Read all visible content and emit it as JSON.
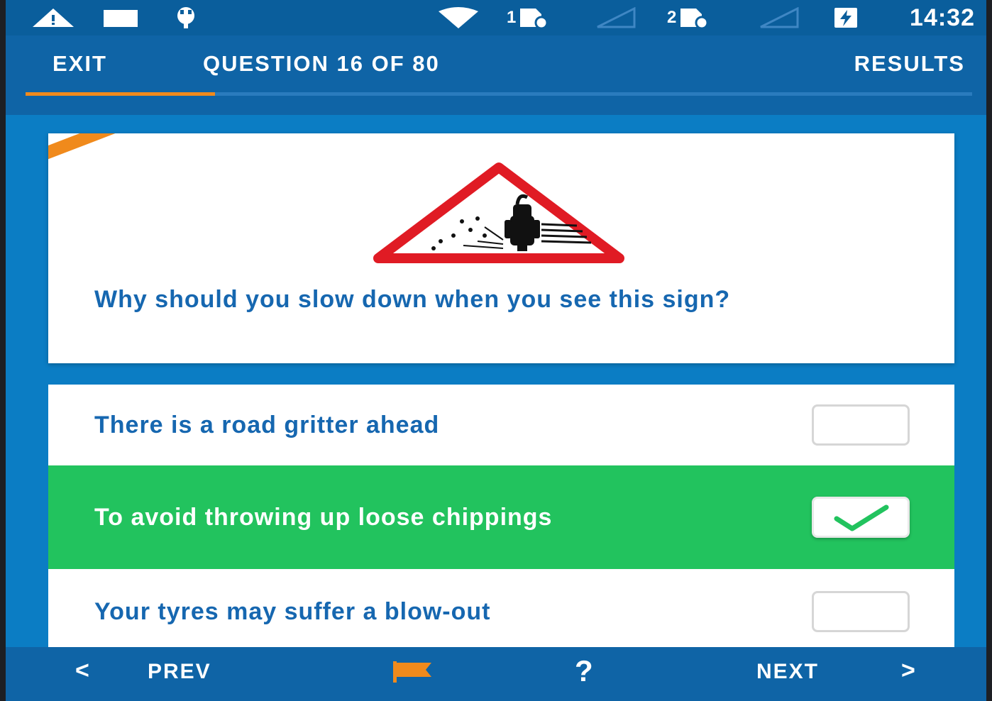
{
  "status_bar": {
    "time": "14:32",
    "sim1": "1",
    "sim2": "2",
    "icons": [
      "warning-icon",
      "notification-icon",
      "usb-icon",
      "wifi-icon",
      "sim1-icon",
      "signal1-icon",
      "sim2-icon",
      "signal2-icon",
      "battery-charging-icon"
    ]
  },
  "app_bar": {
    "exit_label": "EXIT",
    "question_label": "QUESTION 16 OF 80",
    "results_label": "RESULTS",
    "progress": 0.2
  },
  "question": {
    "text": "Why should you slow down when you see this sign?",
    "image": "loose-chippings-warning-sign"
  },
  "answers": [
    {
      "text": "There is a road gritter ahead",
      "selected": false
    },
    {
      "text": "To avoid throwing up loose chippings",
      "selected": true
    },
    {
      "text": "Your tyres may suffer a blow-out",
      "selected": false
    }
  ],
  "bottom_bar": {
    "prev_chevron": "<",
    "prev_label": "PREV",
    "flag_icon": "flag-icon",
    "help_label": "?",
    "next_label": "NEXT",
    "next_chevron": ">"
  },
  "colors": {
    "primary": "#0f64a6",
    "accent": "#f08a1c",
    "correct": "#22c35e",
    "text_blue": "#1667b0"
  }
}
